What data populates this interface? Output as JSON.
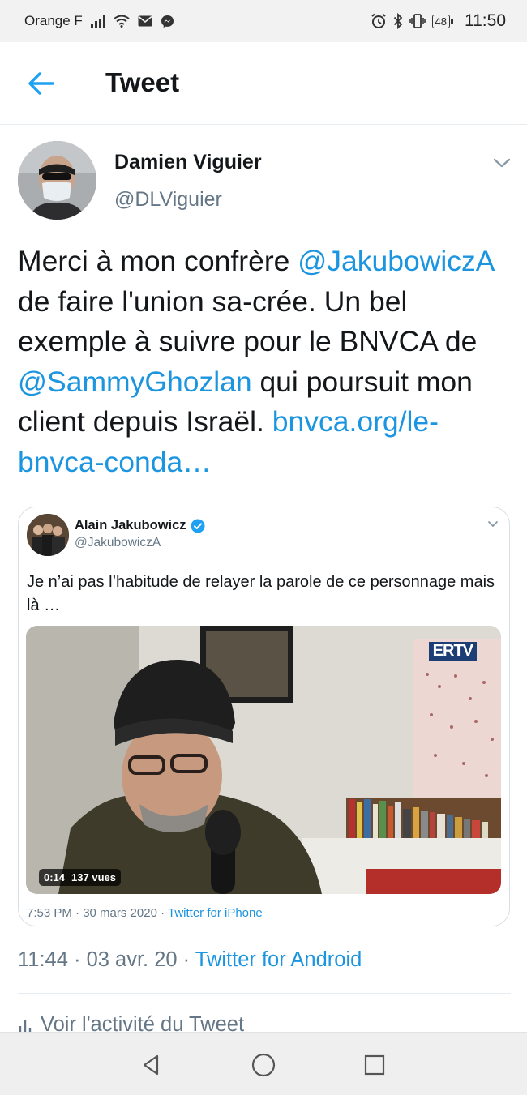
{
  "status_bar": {
    "carrier": "Orange F",
    "battery": "48",
    "time": "11:50",
    "icons": [
      "signal-icon",
      "wifi-icon",
      "mail-icon",
      "messenger-icon",
      "alarm-icon",
      "bluetooth-icon",
      "vibrate-icon",
      "battery-icon"
    ]
  },
  "header": {
    "title": "Tweet",
    "back_icon": "arrow-left-icon"
  },
  "tweet": {
    "author_name": "Damien Viguier",
    "author_handle": "@DLViguier",
    "text_parts": [
      "Merci à mon confrère ",
      "@JakubowiczA",
      " de faire l'union sa-crée. Un bel exemple à suivre pour le BNVCA de ",
      "@SammyGhozlan",
      " qui poursuit mon client depuis Israël. ",
      "bnvca.org/le-bnvca-conda…"
    ],
    "timestamp": "11:44 · 03 avr. 20 · ",
    "source": "Twitter for Android",
    "activity_label": "Voir l'activité du Tweet"
  },
  "quoted_tweet": {
    "author_name": "Alain Jakubowicz",
    "author_handle": "@JakubowiczA",
    "text": "Je n’ai pas l’habitude de relayer la parole de ce personnage mais là …",
    "media": {
      "duration": "0:14",
      "views": "137 vues",
      "channel_logo": "ERTV"
    },
    "timestamp": "7:53 PM · 30 mars 2020 · ",
    "source": "Twitter for iPhone"
  },
  "colors": {
    "link": "#1b95e0",
    "secondary_text": "#657786",
    "primary_text": "#14171a",
    "verified": "#1da1f2"
  },
  "navbar": {
    "icons": [
      "nav-back-icon",
      "nav-home-icon",
      "nav-recent-icon"
    ]
  }
}
